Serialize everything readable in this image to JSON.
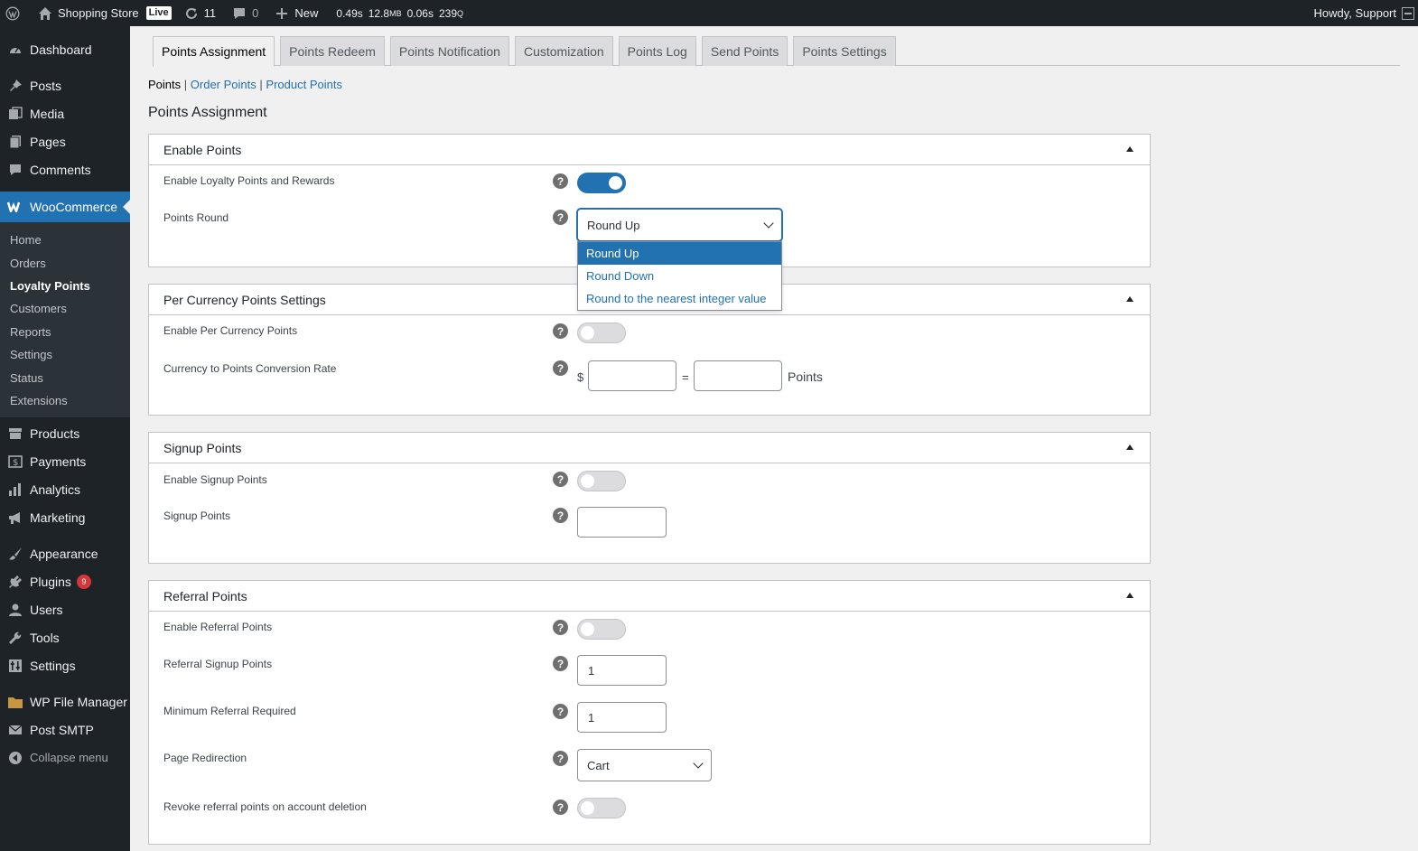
{
  "adminbar": {
    "site_name": "Shopping Store",
    "live_badge": "Live",
    "updates_count": "11",
    "comments_count": "0",
    "new_label": "New",
    "perf_time": "0.49s",
    "perf_mem": "12.8",
    "perf_mem_unit": "MB",
    "perf_db": "0.06s",
    "perf_queries": "239",
    "perf_queries_unit": "Q",
    "greeting": "Howdy, Support"
  },
  "sidebar": {
    "dashboard": "Dashboard",
    "posts": "Posts",
    "media": "Media",
    "pages": "Pages",
    "comments": "Comments",
    "woocommerce": "WooCommerce",
    "submenu": [
      "Home",
      "Orders",
      "Loyalty Points",
      "Customers",
      "Reports",
      "Settings",
      "Status",
      "Extensions"
    ],
    "products": "Products",
    "payments": "Payments",
    "analytics": "Analytics",
    "marketing": "Marketing",
    "appearance": "Appearance",
    "plugins": "Plugins",
    "plugins_badge": "9",
    "users": "Users",
    "tools": "Tools",
    "settings": "Settings",
    "wp_file_manager": "WP File Manager",
    "post_smtp": "Post SMTP",
    "collapse": "Collapse menu"
  },
  "tabs": [
    "Points Assignment",
    "Points Redeem",
    "Points Notification",
    "Customization",
    "Points Log",
    "Send Points",
    "Points Settings"
  ],
  "subsub": {
    "points": "Points",
    "order_points": "Order Points",
    "product_points": "Product Points",
    "sep": "|"
  },
  "page_title": "Points Assignment",
  "enable_points": {
    "title": "Enable Points",
    "enable_label": "Enable Loyalty Points and Rewards",
    "enable_on": true,
    "round_label": "Points Round",
    "round_value": "Round Up",
    "round_options": [
      "Round Up",
      "Round Down",
      "Round to the nearest integer value"
    ]
  },
  "per_currency": {
    "title": "Per Currency Points Settings",
    "enable_label": "Enable Per Currency Points",
    "rate_label": "Currency to Points Conversion Rate",
    "currency_symbol": "$",
    "equals": "=",
    "points_suffix": "Points",
    "currency_value": "",
    "points_value": ""
  },
  "signup": {
    "title": "Signup Points",
    "enable_label": "Enable Signup Points",
    "points_label": "Signup Points",
    "points_value": ""
  },
  "referral": {
    "title": "Referral Points",
    "enable_label": "Enable Referral Points",
    "signup_label": "Referral Signup Points",
    "signup_value": "1",
    "min_label": "Minimum Referral Required",
    "min_value": "1",
    "redirect_label": "Page Redirection",
    "redirect_value": "Cart",
    "revoke_label": "Revoke referral points on account deletion"
  },
  "help_glyph": "?",
  "colors": {
    "admin_dark": "#1d2327",
    "accent": "#2271b1",
    "badge_red": "#d63638"
  }
}
